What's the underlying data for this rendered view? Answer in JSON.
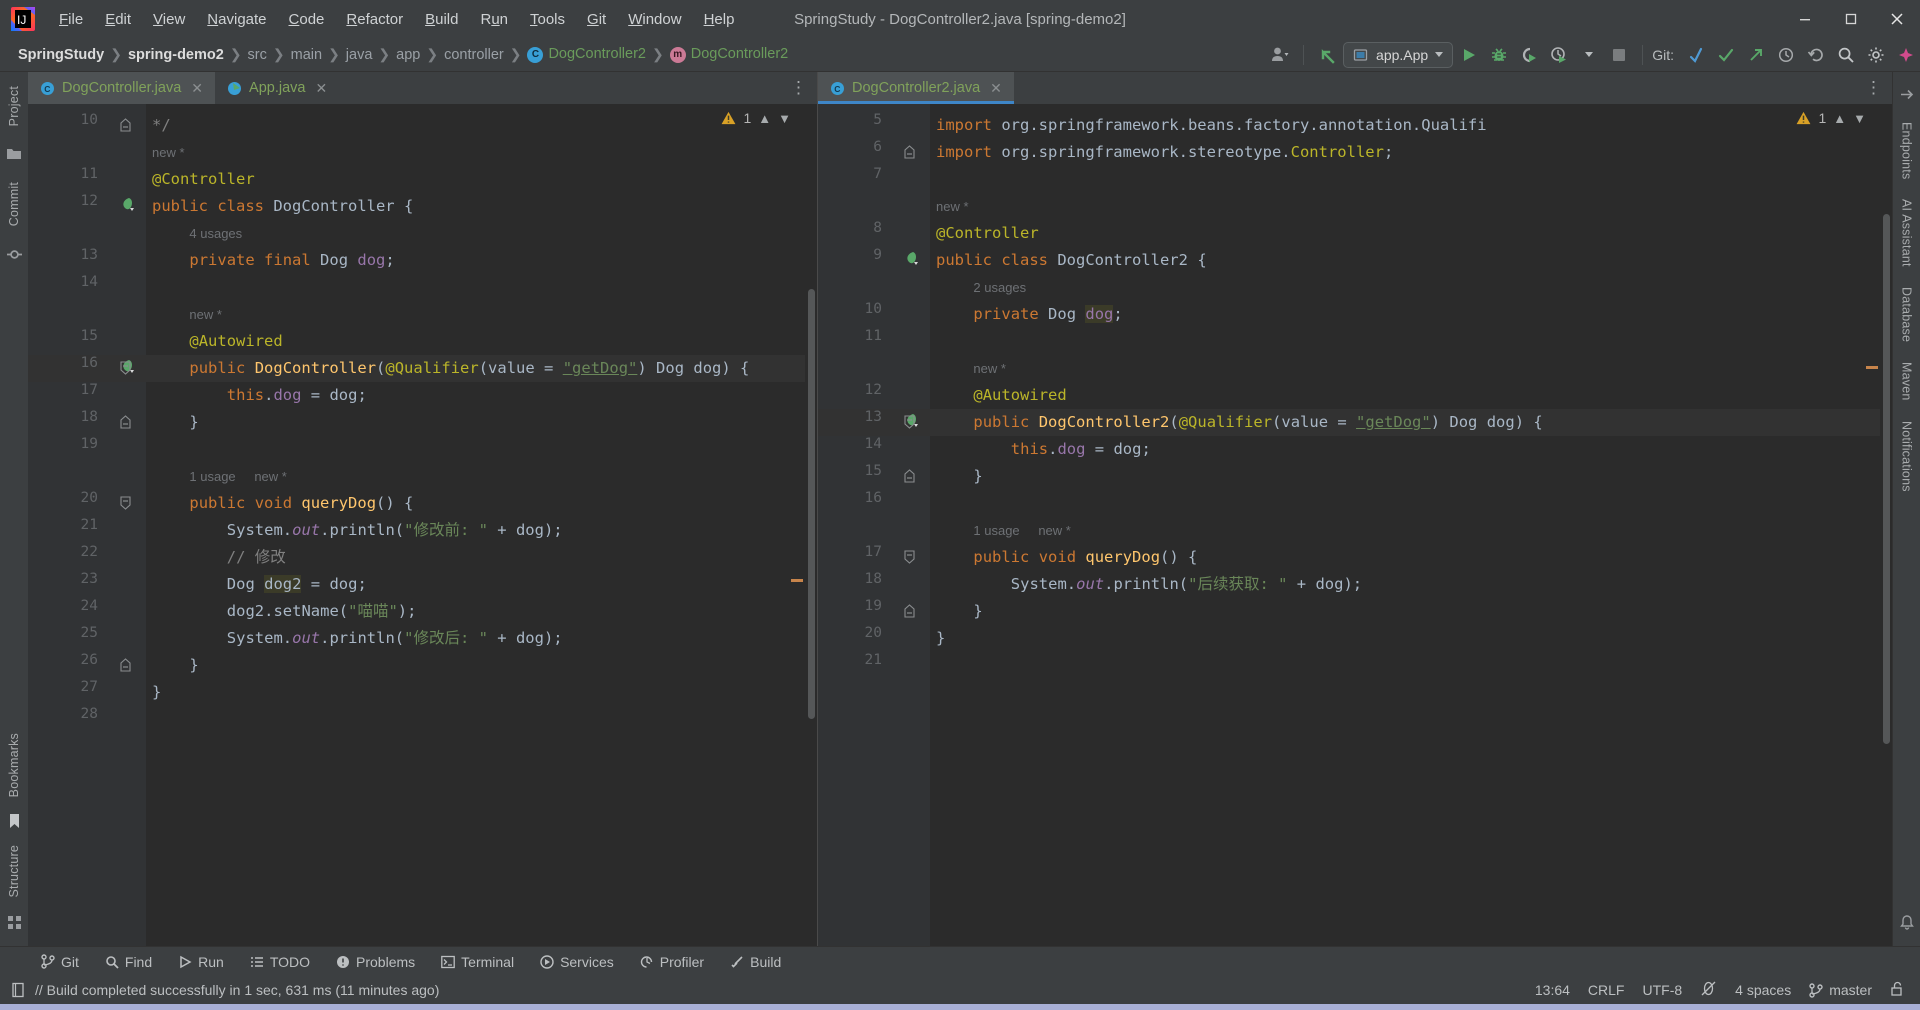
{
  "window": {
    "title": "SpringStudy - DogController2.java [spring-demo2]",
    "controls": [
      "minimize",
      "maximize",
      "close"
    ]
  },
  "menu": [
    {
      "label": "File",
      "mnemonic": "F"
    },
    {
      "label": "Edit",
      "mnemonic": "E"
    },
    {
      "label": "View",
      "mnemonic": "V"
    },
    {
      "label": "Navigate",
      "mnemonic": "N"
    },
    {
      "label": "Code",
      "mnemonic": "C"
    },
    {
      "label": "Refactor",
      "mnemonic": "R"
    },
    {
      "label": "Build",
      "mnemonic": "B"
    },
    {
      "label": "Run",
      "mnemonic": "u"
    },
    {
      "label": "Tools",
      "mnemonic": "T"
    },
    {
      "label": "Git",
      "mnemonic": "G"
    },
    {
      "label": "Window",
      "mnemonic": "W"
    },
    {
      "label": "Help",
      "mnemonic": "H"
    }
  ],
  "breadcrumb": [
    {
      "label": "SpringStudy",
      "style": "bold"
    },
    {
      "label": "spring-demo2",
      "style": "bold"
    },
    {
      "label": "src",
      "style": "normal"
    },
    {
      "label": "main",
      "style": "normal"
    },
    {
      "label": "java",
      "style": "normal"
    },
    {
      "label": "app",
      "style": "normal"
    },
    {
      "label": "controller",
      "style": "normal"
    },
    {
      "label": "DogController2",
      "style": "green",
      "icon": "class-badge-c"
    },
    {
      "label": "DogController2",
      "style": "green",
      "icon": "method-badge-m"
    }
  ],
  "toolbar": {
    "run_config": "app.App",
    "run_config_icon": "application-icon",
    "git_label": "Git:",
    "icons": [
      "user-avatar-icon",
      "back-arrow-icon",
      "run-icon",
      "debug-icon",
      "run-with-coverage-icon",
      "profiler-icon",
      "stop-icon",
      "git-update-icon",
      "git-commit-icon",
      "git-push-icon",
      "git-history-icon",
      "git-rollback-icon",
      "search-icon",
      "settings-icon",
      "ai-assistant-icon"
    ]
  },
  "left_strip": {
    "top": [
      "Project",
      "Commit"
    ],
    "bottom": [
      "Bookmarks",
      "Structure"
    ]
  },
  "right_strip": {
    "items": [
      "Endpoints",
      "AI Assistant",
      "Database",
      "Maven",
      "Notifications"
    ]
  },
  "editor_left": {
    "tabs": [
      {
        "label": "DogController.java",
        "active": true,
        "focused": false,
        "icon": "java-class-icon"
      },
      {
        "label": "App.java",
        "active": false,
        "focused": false,
        "icon": "java-runnable-icon"
      }
    ],
    "warning_count": "1",
    "lines": [
      {
        "num": "10",
        "indent": 0,
        "fold": "end",
        "tokens": [
          {
            "t": "*/",
            "c": "cmt"
          }
        ]
      },
      {
        "num": "",
        "indent": 0,
        "hint": "new *"
      },
      {
        "num": "11",
        "indent": 0,
        "tokens": [
          {
            "t": "@Controller",
            "c": "ann"
          }
        ]
      },
      {
        "num": "12",
        "indent": 0,
        "bean": true,
        "tokens": [
          {
            "t": "public ",
            "c": "kw"
          },
          {
            "t": "class ",
            "c": "kw"
          },
          {
            "t": "DogController ",
            "c": "cls"
          },
          {
            "t": "{",
            "c": "plain"
          }
        ]
      },
      {
        "num": "",
        "indent": 1,
        "usages": "4 usages"
      },
      {
        "num": "13",
        "indent": 1,
        "tokens": [
          {
            "t": "private ",
            "c": "kw"
          },
          {
            "t": "final ",
            "c": "kw"
          },
          {
            "t": "Dog ",
            "c": "cls"
          },
          {
            "t": "dog",
            "c": "fld"
          },
          {
            "t": ";",
            "c": "plain"
          }
        ]
      },
      {
        "num": "14",
        "indent": 0,
        "tokens": []
      },
      {
        "num": "",
        "indent": 1,
        "hint": "new *"
      },
      {
        "num": "15",
        "indent": 1,
        "tokens": [
          {
            "t": "@Autowired",
            "c": "ann"
          }
        ]
      },
      {
        "num": "16",
        "indent": 1,
        "bean": true,
        "fold": "start",
        "highlight": true,
        "tokens": [
          {
            "t": "public ",
            "c": "kw"
          },
          {
            "t": "DogController",
            "c": "mth"
          },
          {
            "t": "(",
            "c": "plain"
          },
          {
            "t": "@Qualifier",
            "c": "ann"
          },
          {
            "t": "(value = ",
            "c": "plain"
          },
          {
            "t": "\"getDog\"",
            "c": "ustr"
          },
          {
            "t": ") Dog dog) {",
            "c": "plain"
          }
        ]
      },
      {
        "num": "17",
        "indent": 2,
        "tokens": [
          {
            "t": "this",
            "c": "kw"
          },
          {
            "t": ".",
            "c": "plain"
          },
          {
            "t": "dog",
            "c": "fld"
          },
          {
            "t": " = dog;",
            "c": "plain"
          }
        ]
      },
      {
        "num": "18",
        "indent": 1,
        "fold": "end",
        "tokens": [
          {
            "t": "}",
            "c": "plain"
          }
        ]
      },
      {
        "num": "19",
        "indent": 0,
        "tokens": []
      },
      {
        "num": "",
        "indent": 1,
        "usages": "1 usage",
        "hint": "new *"
      },
      {
        "num": "20",
        "indent": 1,
        "fold": "start",
        "tokens": [
          {
            "t": "public ",
            "c": "kw"
          },
          {
            "t": "void ",
            "c": "kw"
          },
          {
            "t": "queryDog",
            "c": "mth"
          },
          {
            "t": "() {",
            "c": "plain"
          }
        ]
      },
      {
        "num": "21",
        "indent": 2,
        "tokens": [
          {
            "t": "System",
            "c": "plain"
          },
          {
            "t": ".",
            "c": "plain"
          },
          {
            "t": "out",
            "c": "stat"
          },
          {
            "t": ".println(",
            "c": "plain"
          },
          {
            "t": "\"修改前: \"",
            "c": "str"
          },
          {
            "t": " + dog);",
            "c": "plain"
          }
        ]
      },
      {
        "num": "22",
        "indent": 2,
        "tokens": [
          {
            "t": "// 修改",
            "c": "cmt"
          }
        ]
      },
      {
        "num": "23",
        "indent": 2,
        "tokens": [
          {
            "t": "Dog ",
            "c": "cls"
          },
          {
            "t": "dog2",
            "c": "hl"
          },
          {
            "t": " = dog;",
            "c": "plain"
          }
        ]
      },
      {
        "num": "24",
        "indent": 2,
        "tokens": [
          {
            "t": "dog2.setName(",
            "c": "plain"
          },
          {
            "t": "\"喵喵\"",
            "c": "str"
          },
          {
            "t": ");",
            "c": "plain"
          }
        ]
      },
      {
        "num": "25",
        "indent": 2,
        "tokens": [
          {
            "t": "System",
            "c": "plain"
          },
          {
            "t": ".",
            "c": "plain"
          },
          {
            "t": "out",
            "c": "stat"
          },
          {
            "t": ".println(",
            "c": "plain"
          },
          {
            "t": "\"修改后: \"",
            "c": "str"
          },
          {
            "t": " + dog);",
            "c": "plain"
          }
        ]
      },
      {
        "num": "26",
        "indent": 1,
        "fold": "end",
        "tokens": [
          {
            "t": "}",
            "c": "plain"
          }
        ]
      },
      {
        "num": "27",
        "indent": 0,
        "tokens": [
          {
            "t": "}",
            "c": "plain"
          }
        ]
      },
      {
        "num": "28",
        "indent": 0,
        "tokens": []
      }
    ]
  },
  "editor_right": {
    "tabs": [
      {
        "label": "DogController2.java",
        "active": true,
        "focused": true,
        "icon": "java-class-icon"
      }
    ],
    "warning_count": "1",
    "lines": [
      {
        "num": "5",
        "indent": 0,
        "tokens": [
          {
            "t": "import ",
            "c": "kw"
          },
          {
            "t": "org.springframework.beans.factory.annotation.Qualifi",
            "c": "plain"
          }
        ]
      },
      {
        "num": "6",
        "indent": 0,
        "fold": "end",
        "tokens": [
          {
            "t": "import ",
            "c": "kw"
          },
          {
            "t": "org.springframework.stereotype.",
            "c": "plain"
          },
          {
            "t": "Controller",
            "c": "ann"
          },
          {
            "t": ";",
            "c": "plain"
          }
        ]
      },
      {
        "num": "7",
        "indent": 0,
        "tokens": []
      },
      {
        "num": "",
        "indent": 0,
        "hint": "new *"
      },
      {
        "num": "8",
        "indent": 0,
        "tokens": [
          {
            "t": "@Controller",
            "c": "ann"
          }
        ]
      },
      {
        "num": "9",
        "indent": 0,
        "bean": true,
        "tokens": [
          {
            "t": "public ",
            "c": "kw"
          },
          {
            "t": "class ",
            "c": "kw"
          },
          {
            "t": "DogController2 ",
            "c": "cls"
          },
          {
            "t": "{",
            "c": "plain"
          }
        ]
      },
      {
        "num": "",
        "indent": 1,
        "usages": "2 usages"
      },
      {
        "num": "10",
        "indent": 1,
        "tokens": [
          {
            "t": "private ",
            "c": "kw"
          },
          {
            "t": "Dog ",
            "c": "cls"
          },
          {
            "t": "dog",
            "c": "hlfld"
          },
          {
            "t": ";",
            "c": "plain"
          }
        ]
      },
      {
        "num": "11",
        "indent": 0,
        "tokens": []
      },
      {
        "num": "",
        "indent": 1,
        "hint": "new *"
      },
      {
        "num": "12",
        "indent": 1,
        "tokens": [
          {
            "t": "@Autowired",
            "c": "ann"
          }
        ]
      },
      {
        "num": "13",
        "indent": 1,
        "bean": true,
        "fold": "start",
        "highlight": true,
        "tokens": [
          {
            "t": "public ",
            "c": "kw"
          },
          {
            "t": "DogController2",
            "c": "mth"
          },
          {
            "t": "(",
            "c": "plain"
          },
          {
            "t": "@Qualifier",
            "c": "ann"
          },
          {
            "t": "(value = ",
            "c": "plain"
          },
          {
            "t": "\"getDog\"",
            "c": "ustr"
          },
          {
            "t": ") Dog dog) {",
            "c": "plain"
          }
        ]
      },
      {
        "num": "14",
        "indent": 2,
        "tokens": [
          {
            "t": "this",
            "c": "kw"
          },
          {
            "t": ".",
            "c": "plain"
          },
          {
            "t": "dog",
            "c": "fld"
          },
          {
            "t": " = dog;",
            "c": "plain"
          }
        ]
      },
      {
        "num": "15",
        "indent": 1,
        "fold": "end",
        "tokens": [
          {
            "t": "}",
            "c": "plain"
          }
        ]
      },
      {
        "num": "16",
        "indent": 0,
        "tokens": []
      },
      {
        "num": "",
        "indent": 1,
        "usages": "1 usage",
        "hint": "new *"
      },
      {
        "num": "17",
        "indent": 1,
        "fold": "start",
        "tokens": [
          {
            "t": "public ",
            "c": "kw"
          },
          {
            "t": "void ",
            "c": "kw"
          },
          {
            "t": "queryDog",
            "c": "mth"
          },
          {
            "t": "() {",
            "c": "plain"
          }
        ]
      },
      {
        "num": "18",
        "indent": 2,
        "tokens": [
          {
            "t": "System",
            "c": "plain"
          },
          {
            "t": ".",
            "c": "plain"
          },
          {
            "t": "out",
            "c": "stat"
          },
          {
            "t": ".println(",
            "c": "plain"
          },
          {
            "t": "\"后续获取: \"",
            "c": "str"
          },
          {
            "t": " + dog);",
            "c": "plain"
          }
        ]
      },
      {
        "num": "19",
        "indent": 1,
        "fold": "end",
        "tokens": [
          {
            "t": "}",
            "c": "plain"
          }
        ]
      },
      {
        "num": "20",
        "indent": 0,
        "tokens": [
          {
            "t": "}",
            "c": "plain"
          }
        ]
      },
      {
        "num": "21",
        "indent": 0,
        "tokens": []
      }
    ]
  },
  "bottom_tools": [
    {
      "label": "Git",
      "icon": "git-branch-icon"
    },
    {
      "label": "Find",
      "icon": "search-icon"
    },
    {
      "label": "Run",
      "icon": "play-icon"
    },
    {
      "label": "TODO",
      "icon": "list-icon"
    },
    {
      "label": "Problems",
      "icon": "error-icon"
    },
    {
      "label": "Terminal",
      "icon": "terminal-icon"
    },
    {
      "label": "Services",
      "icon": "services-icon"
    },
    {
      "label": "Profiler",
      "icon": "profiler-icon"
    },
    {
      "label": "Build",
      "icon": "build-hammer-icon"
    }
  ],
  "status": {
    "message": "// Build completed successfully in 1 sec, 631 ms (11 minutes ago)",
    "message_icon": "build-log-icon",
    "caret_position": "13:64",
    "line_separator": "CRLF",
    "encoding": "UTF-8",
    "inspection": "no-inspection-icon",
    "indent": "4 spaces",
    "branch": "master",
    "branch_icon": "git-branch-icon",
    "lock": "unlocked-icon"
  },
  "colors": {
    "accent_blue": "#3e86c8",
    "keyword_orange": "#cc7832",
    "string_green": "#6a8759",
    "annotation_yellow": "#bbb529",
    "field_purple": "#9876aa",
    "method_gold": "#ffc66d",
    "editor_bg": "#2b2b2b",
    "chrome_bg": "#3c3f41",
    "gutter_bg": "#313335",
    "run_green": "#59a869",
    "warning_yellow": "#d9a126"
  }
}
